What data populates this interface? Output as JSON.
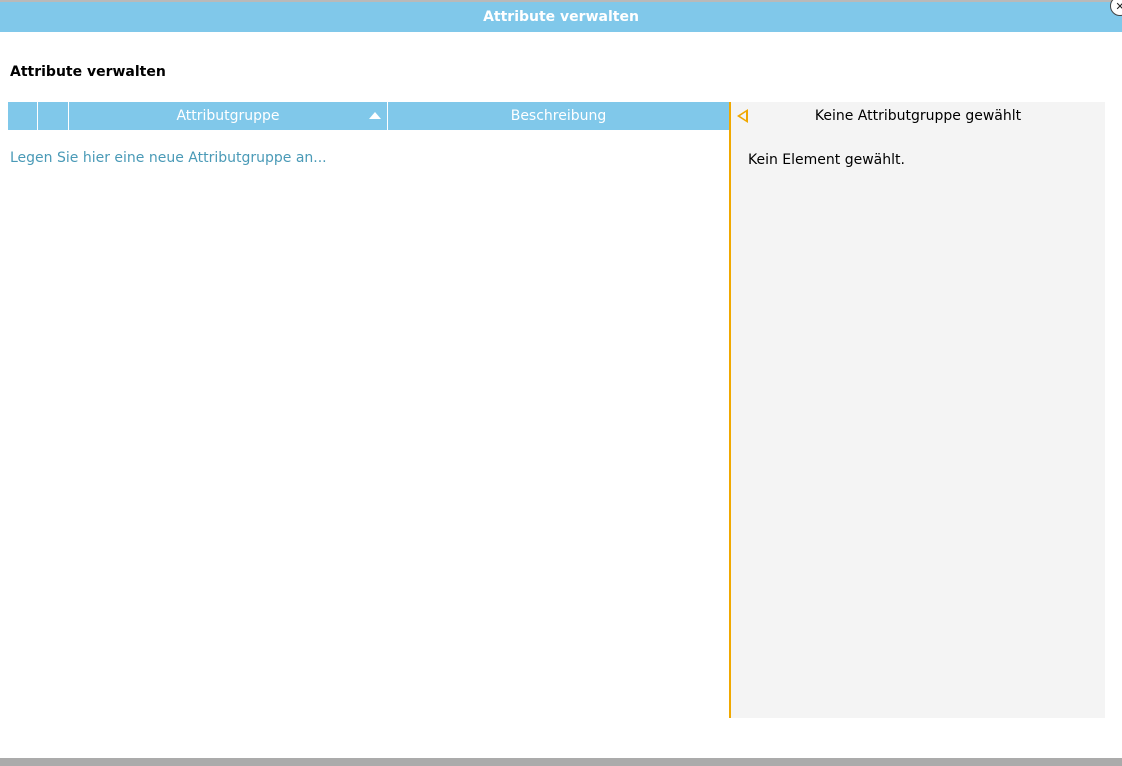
{
  "window": {
    "title": "Attribute verwalten",
    "close_symbol": "✕"
  },
  "main": {
    "section_title": "Attribute verwalten",
    "grid": {
      "columns": [
        "",
        "",
        "Attributgruppe",
        "Beschreibung"
      ],
      "sort_column": "Attributgruppe",
      "sort_direction": "ascending"
    },
    "add_link": "Legen Sie hier eine neue Attributgruppe an..."
  },
  "detail_panel": {
    "title": "Keine Attributgruppe gewählt",
    "message": "Kein Element gewählt."
  },
  "colors": {
    "accent": "#80c8ea",
    "highlight": "#f0a800",
    "link": "#4a9ab7",
    "panel_bg": "#f4f4f4"
  }
}
